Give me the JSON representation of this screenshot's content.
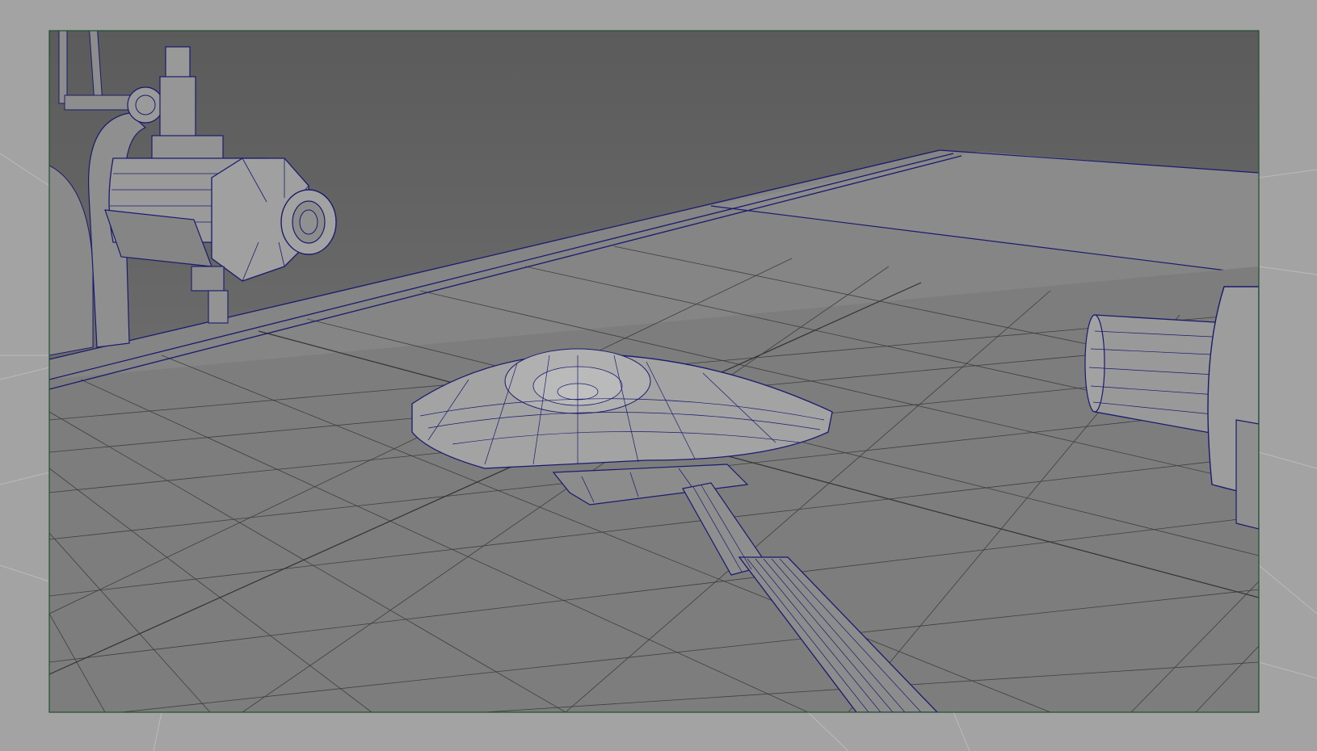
{
  "viewport": {
    "camera_label": "",
    "gate_frame_color": "#1f4e2e",
    "wire_color": "#1a1a6e",
    "background_upper": "#5d5d5d",
    "background_lower": "#a3a3a3",
    "grid_color": "#3f3f3f",
    "shaded_surface": "#8a8a8a"
  },
  "scene_objects": [
    {
      "name": "faucet",
      "icon": "faucet-mesh"
    },
    {
      "name": "brush-head",
      "icon": "brush-mesh"
    },
    {
      "name": "brush-handle",
      "icon": "handle-mesh"
    },
    {
      "name": "cylinder-object",
      "icon": "cylinder-mesh"
    },
    {
      "name": "sink-counter",
      "icon": "plane-mesh"
    }
  ]
}
